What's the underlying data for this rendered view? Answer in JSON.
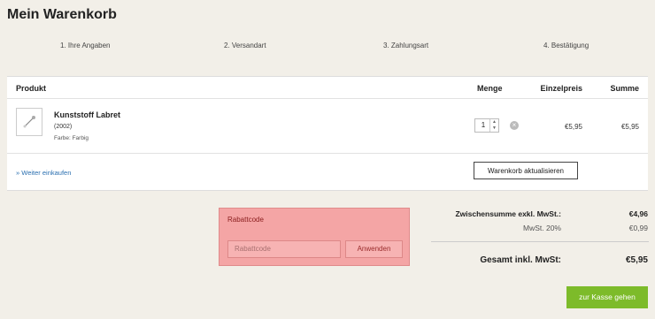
{
  "page": {
    "title": "Mein Warenkorb"
  },
  "steps": [
    "1. Ihre Angaben",
    "2. Versandart",
    "3. Zahlungsart",
    "4. Bestätigung"
  ],
  "cart": {
    "headers": {
      "product": "Produkt",
      "quantity": "Menge",
      "unit_price": "Einzelpreis",
      "total": "Summe"
    },
    "items": [
      {
        "name": "Kunststoff Labret",
        "code": "(2002)",
        "color": "Farbe: Farbig",
        "quantity": "1",
        "unit_price": "€5,95",
        "total": "€5,95",
        "icon": "product-thumbnail"
      }
    ],
    "continue_link": "» Weiter einkaufen",
    "update_button": "Warenkorb aktualisieren"
  },
  "coupon": {
    "title": "Rabattcode",
    "placeholder": "Rabattcode",
    "apply_button": "Anwenden"
  },
  "totals": {
    "subtotal_label": "Zwischensumme exkl. MwSt.:",
    "subtotal_value": "€4,96",
    "tax_label": "MwSt. 20%",
    "tax_value": "€0,99",
    "grand_label": "Gesamt inkl. MwSt:",
    "grand_value": "€5,95"
  },
  "checkout_button": "zur Kasse gehen",
  "colors": {
    "accent": "#7dbb2a",
    "coupon_bg": "#f4a5a5",
    "link": "#2a6fb0"
  }
}
